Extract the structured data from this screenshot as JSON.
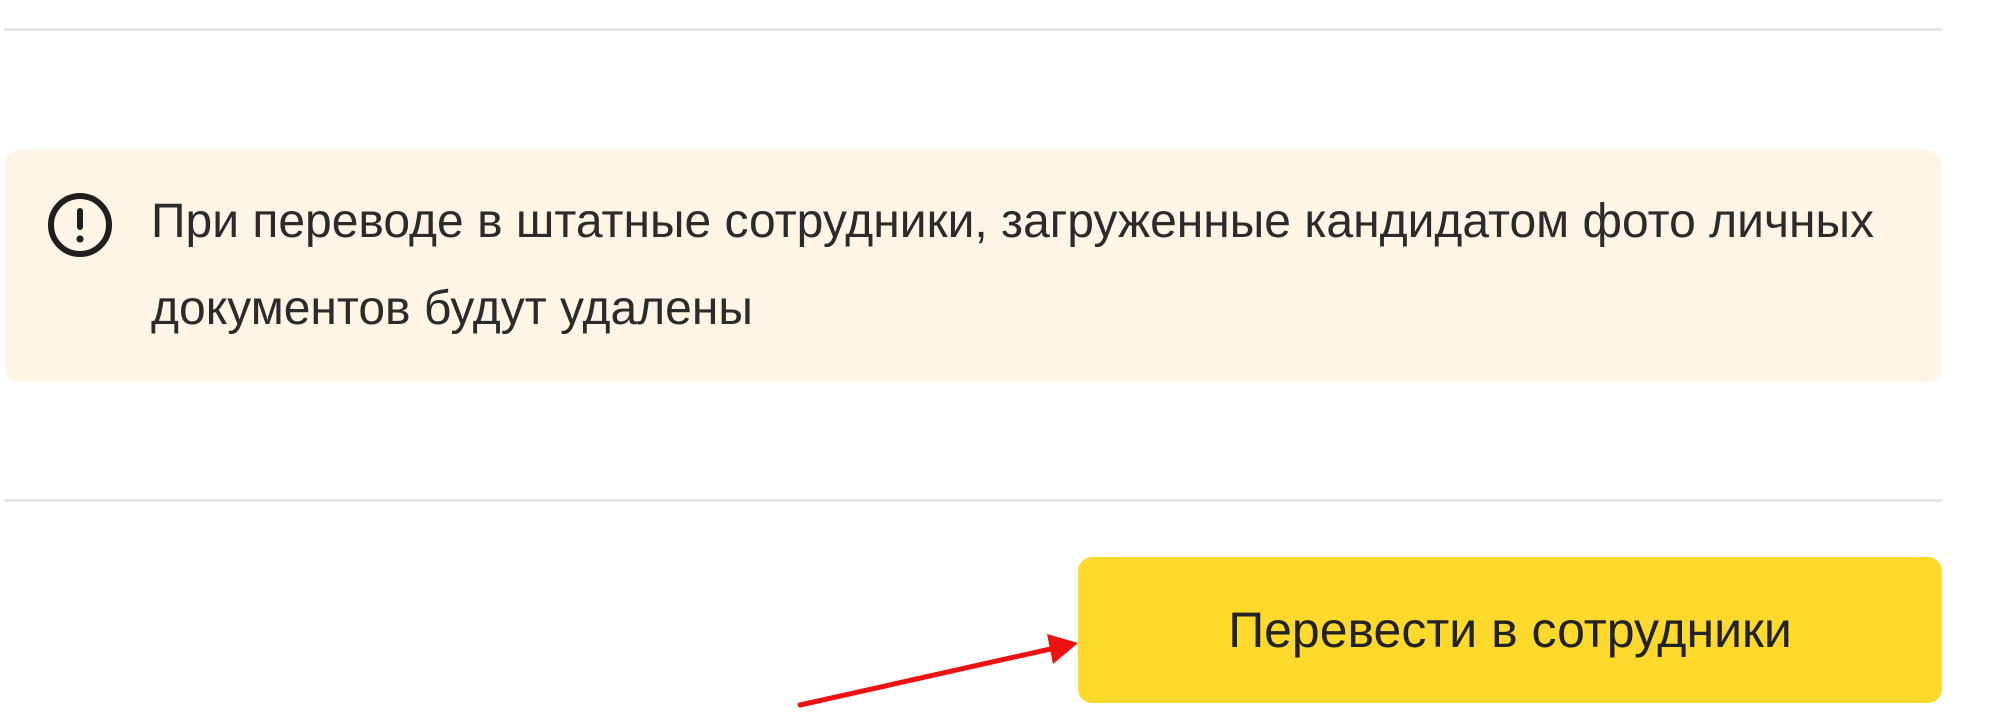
{
  "notice": {
    "icon": "exclamation-circle-icon",
    "text": "При переводе в штатные сотрудники, загруженные кандидатом фото личных документов будут удалены"
  },
  "actions": {
    "transfer_label": "Перевести в сотрудники"
  },
  "colors": {
    "notice_background": "#fff5e6",
    "button_background": "#fdd92b",
    "annotation_arrow": "#ee1111"
  }
}
